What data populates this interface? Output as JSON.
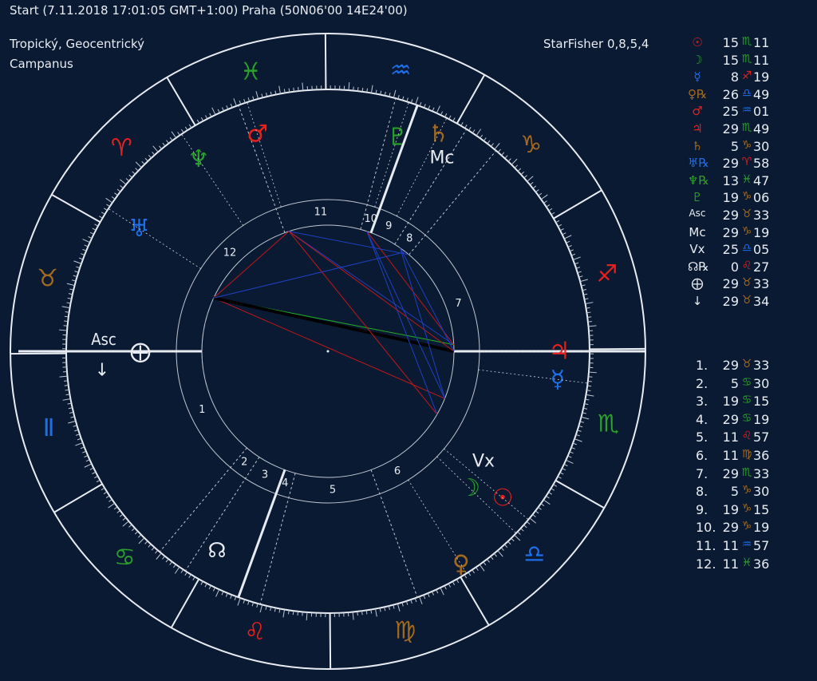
{
  "header": {
    "chart_info": "Start (7.11.2018 17:01:05 GMT+1:00) Praha (50N06'00 14E24'00)",
    "zodiac_type": "Tropický, Geocentrický",
    "house_system": "Campanus",
    "software": "StarFisher 0,8,5,4"
  },
  "colors": {
    "background": "#0a1a33",
    "fire": "#e8201c",
    "earth": "#a36a1f",
    "air": "#1e6fe8",
    "water": "#2aa12a",
    "white": "#e8ecf2"
  },
  "zodiac_signs": [
    {
      "name": "aries",
      "glyph": "♈",
      "element": "fire"
    },
    {
      "name": "taurus",
      "glyph": "♉",
      "element": "earth"
    },
    {
      "name": "gemini",
      "glyph": "Ⅱ",
      "element": "air"
    },
    {
      "name": "cancer",
      "glyph": "♋",
      "element": "water"
    },
    {
      "name": "leo",
      "glyph": "♌",
      "element": "fire"
    },
    {
      "name": "virgo",
      "glyph": "♍",
      "element": "earth"
    },
    {
      "name": "libra",
      "glyph": "♎",
      "element": "air"
    },
    {
      "name": "scorpio",
      "glyph": "♏",
      "element": "water"
    },
    {
      "name": "sagittarius",
      "glyph": "♐",
      "element": "fire"
    },
    {
      "name": "capricorn",
      "glyph": "♑",
      "element": "earth"
    },
    {
      "name": "aquarius",
      "glyph": "♒",
      "element": "air"
    },
    {
      "name": "pisces",
      "glyph": "♓",
      "element": "water"
    }
  ],
  "chart_labels": {
    "asc": "Asc",
    "mc": "Mc",
    "vx": "Vx",
    "node": "☊",
    "fortune": "⨁",
    "vertex_down": "↓"
  },
  "chart_planets": [
    {
      "name": "sun",
      "glyph": "☉",
      "element": "fire"
    },
    {
      "name": "moon",
      "glyph": "☽",
      "element": "water"
    },
    {
      "name": "mercury",
      "glyph": "☿",
      "element": "air"
    },
    {
      "name": "venus",
      "glyph": "♀",
      "element": "earth"
    },
    {
      "name": "mars",
      "glyph": "♂",
      "element": "fire"
    },
    {
      "name": "jupiter",
      "glyph": "♃",
      "element": "fire"
    },
    {
      "name": "saturn",
      "glyph": "♄",
      "element": "earth"
    },
    {
      "name": "uranus",
      "glyph": "♅",
      "element": "air"
    },
    {
      "name": "neptune",
      "glyph": "♆",
      "element": "water"
    },
    {
      "name": "pluto",
      "glyph": "♇",
      "element": "water"
    }
  ],
  "house_numbers": [
    "1",
    "2",
    "3",
    "4",
    "5",
    "6",
    "7",
    "8",
    "9",
    "10",
    "11",
    "12"
  ],
  "planet_table": [
    {
      "name": "sun",
      "symbol": "☉",
      "color": "#e8201c",
      "deg": "15",
      "sign": "♏",
      "sign_color": "#2aa12a",
      "min": "11"
    },
    {
      "name": "moon",
      "symbol": "☽",
      "color": "#2aa12a",
      "deg": "15",
      "sign": "♏",
      "sign_color": "#2aa12a",
      "min": "11"
    },
    {
      "name": "mercury",
      "symbol": "☿",
      "color": "#1e6fe8",
      "deg": "8",
      "sign": "♐",
      "sign_color": "#e8201c",
      "min": "19"
    },
    {
      "name": "venus-retrograde",
      "symbol": "♀℞",
      "color": "#a36a1f",
      "deg": "26",
      "sign": "♎",
      "sign_color": "#1e6fe8",
      "min": "49"
    },
    {
      "name": "mars",
      "symbol": "♂",
      "color": "#e8201c",
      "deg": "25",
      "sign": "♒",
      "sign_color": "#1e6fe8",
      "min": "01"
    },
    {
      "name": "jupiter",
      "symbol": "♃",
      "color": "#e8201c",
      "deg": "29",
      "sign": "♏",
      "sign_color": "#2aa12a",
      "min": "49"
    },
    {
      "name": "saturn",
      "symbol": "♄",
      "color": "#a36a1f",
      "deg": "5",
      "sign": "♑",
      "sign_color": "#a36a1f",
      "min": "30"
    },
    {
      "name": "uranus-retrograde",
      "symbol": "♅℞",
      "color": "#1e6fe8",
      "deg": "29",
      "sign": "♈",
      "sign_color": "#e8201c",
      "min": "58"
    },
    {
      "name": "neptune-retrograde",
      "symbol": "♆℞",
      "color": "#2aa12a",
      "deg": "13",
      "sign": "♓",
      "sign_color": "#2aa12a",
      "min": "47"
    },
    {
      "name": "pluto",
      "symbol": "♇",
      "color": "#2aa12a",
      "deg": "19",
      "sign": "♑",
      "sign_color": "#a36a1f",
      "min": "06"
    },
    {
      "name": "ascendant",
      "symbol": "Asc",
      "color": "#e8ecf2",
      "deg": "29",
      "sign": "♉",
      "sign_color": "#a36a1f",
      "min": "33"
    },
    {
      "name": "midheaven",
      "symbol": "Mc",
      "color": "#e8ecf2",
      "deg": "29",
      "sign": "♑",
      "sign_color": "#a36a1f",
      "min": "19"
    },
    {
      "name": "vertex",
      "symbol": "Vx",
      "color": "#e8ecf2",
      "deg": "25",
      "sign": "♎",
      "sign_color": "#1e6fe8",
      "min": "05"
    },
    {
      "name": "node-retrograde",
      "symbol": "☊℞",
      "color": "#e8ecf2",
      "deg": "0",
      "sign": "♌",
      "sign_color": "#e8201c",
      "min": "27"
    },
    {
      "name": "part-of-fortune",
      "symbol": "⨁",
      "color": "#e8ecf2",
      "deg": "29",
      "sign": "♉",
      "sign_color": "#a36a1f",
      "min": "33"
    },
    {
      "name": "down-arrow-point",
      "symbol": "↓",
      "color": "#e8ecf2",
      "deg": "29",
      "sign": "♉",
      "sign_color": "#a36a1f",
      "min": "34"
    }
  ],
  "house_table": [
    {
      "num": "1.",
      "deg": "29",
      "sign": "♉",
      "sign_color": "#a36a1f",
      "min": "33"
    },
    {
      "num": "2.",
      "deg": "5",
      "sign": "♋",
      "sign_color": "#2aa12a",
      "min": "30"
    },
    {
      "num": "3.",
      "deg": "19",
      "sign": "♋",
      "sign_color": "#2aa12a",
      "min": "15"
    },
    {
      "num": "4.",
      "deg": "29",
      "sign": "♋",
      "sign_color": "#2aa12a",
      "min": "19"
    },
    {
      "num": "5.",
      "deg": "11",
      "sign": "♌",
      "sign_color": "#e8201c",
      "min": "57"
    },
    {
      "num": "6.",
      "deg": "11",
      "sign": "♍",
      "sign_color": "#a36a1f",
      "min": "36"
    },
    {
      "num": "7.",
      "deg": "29",
      "sign": "♏",
      "sign_color": "#2aa12a",
      "min": "33"
    },
    {
      "num": "8.",
      "deg": "5",
      "sign": "♑",
      "sign_color": "#a36a1f",
      "min": "30"
    },
    {
      "num": "9.",
      "deg": "19",
      "sign": "♑",
      "sign_color": "#a36a1f",
      "min": "15"
    },
    {
      "num": "10.",
      "deg": "29",
      "sign": "♑",
      "sign_color": "#a36a1f",
      "min": "19"
    },
    {
      "num": "11.",
      "deg": "11",
      "sign": "♒",
      "sign_color": "#1e6fe8",
      "min": "57"
    },
    {
      "num": "12.",
      "deg": "11",
      "sign": "♓",
      "sign_color": "#2aa12a",
      "min": "36"
    }
  ]
}
